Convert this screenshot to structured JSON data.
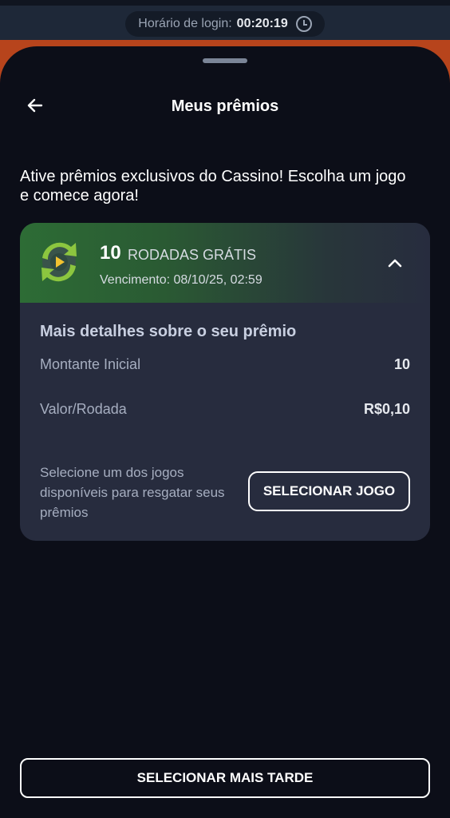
{
  "status_bar": {
    "login_label": "Horário de login:",
    "login_time": "00:20:19",
    "icon": "clock-icon"
  },
  "header": {
    "back_icon": "arrow-left-icon",
    "title": "Meus prêmios"
  },
  "intro_text": "Ative prêmios exclusivos do Cassino! Escolha um jogo e comece agora!",
  "prize_card": {
    "icon": "free-spins-icon",
    "count": "10",
    "type": "RODADAS GRÁTIS",
    "expiry": "Vencimento: 08/10/25, 02:59",
    "collapse_icon": "chevron-up-icon",
    "details_title": "Mais detalhes sobre o seu prêmio",
    "rows": [
      {
        "label": "Montante Inicial",
        "value": "10"
      },
      {
        "label": "Valor/Rodada",
        "value": "R$0,10"
      }
    ],
    "select_text": "Selecione um dos jogos disponíveis para resgatar seus prêmios",
    "select_button": "SELECIONAR JOGO"
  },
  "footer": {
    "later_button": "SELECIONAR MAIS TARDE"
  },
  "colors": {
    "sheet_bg": "#0c0e18",
    "card_bg": "#272c3e",
    "header_green": "#2d6c35",
    "accent_orange": "#b7441c"
  }
}
